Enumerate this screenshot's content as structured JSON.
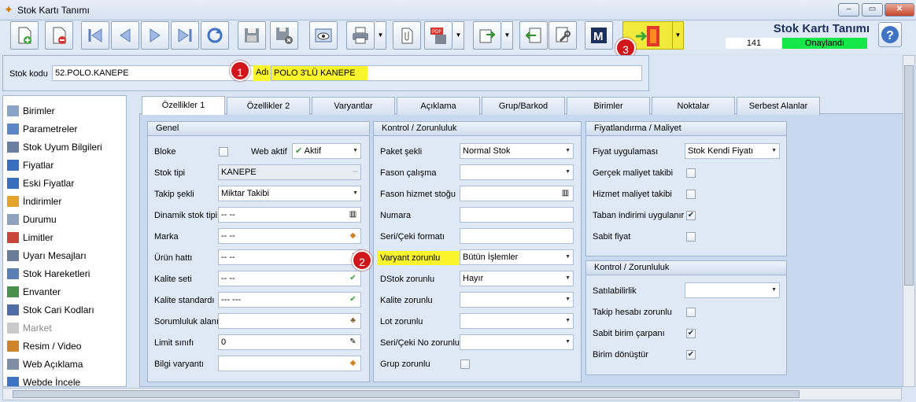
{
  "window": {
    "title": "Stok Kartı Tanımı"
  },
  "header": {
    "form_title": "Stok Kartı Tanımı",
    "record_no": "141",
    "status": "Onaylandı",
    "status_color": "#17e84a"
  },
  "toolbar": {
    "buttons": [
      "new-file",
      "delete-file",
      "first-record",
      "previous-record",
      "next-record",
      "last-record",
      "refresh",
      "save",
      "save-cancel",
      "preview",
      "print",
      "attach",
      "pdf-save",
      "export",
      "import",
      "tools",
      "m-module",
      "exit"
    ]
  },
  "badges": {
    "b1": "1",
    "b2": "2",
    "b3": "3"
  },
  "stock": {
    "code_label": "Stok kodu",
    "code_value": "52.POLO.KANEPE",
    "name_label": "Adı",
    "name_value": "POLO 3'LÜ KANEPE"
  },
  "sidebar": {
    "items": [
      {
        "label": "Birimler",
        "icon": "units-icon"
      },
      {
        "label": "Parametreler",
        "icon": "parameters-icon"
      },
      {
        "label": "Stok Uyum Bilgileri",
        "icon": "compatibility-icon"
      },
      {
        "label": "Fiyatlar",
        "icon": "prices-icon"
      },
      {
        "label": "Eski Fiyatlar",
        "icon": "old-prices-icon"
      },
      {
        "label": "İndirimler",
        "icon": "discounts-icon"
      },
      {
        "label": "Durumu",
        "icon": "status-icon"
      },
      {
        "label": "Limitler",
        "icon": "limits-icon"
      },
      {
        "label": "Uyarı Mesajları",
        "icon": "warning-icon"
      },
      {
        "label": "Stok Hareketleri",
        "icon": "movements-icon"
      },
      {
        "label": "Envanter",
        "icon": "inventory-icon"
      },
      {
        "label": "Stok Cari Kodları",
        "icon": "account-codes-icon"
      },
      {
        "label": "Market",
        "icon": "market-icon"
      },
      {
        "label": "Resim / Video",
        "icon": "media-icon"
      },
      {
        "label": "Web Açıklama",
        "icon": "web-description-icon"
      },
      {
        "label": "Webde İncele",
        "icon": "web-view-icon"
      }
    ]
  },
  "tabs": [
    "Özellikler 1",
    "Özellikler 2",
    "Varyantlar",
    "Açıklama",
    "Grup/Barkod",
    "Birimler",
    "Noktalar",
    "Serbest Alanlar"
  ],
  "genel": {
    "title": "Genel",
    "bloke": "Bloke",
    "web_aktif": "Web aktif",
    "web_aktif_value": "Aktif",
    "stok_tipi": "Stok tipi",
    "stok_tipi_value": "KANEPE",
    "takip": "Takip şekli",
    "takip_value": "Miktar Takibi",
    "dinamik": "Dinamik stok tipi",
    "dinamik_value": "-- --",
    "marka": "Marka",
    "marka_value": "-- --",
    "urun_hatti": "Ürün hattı",
    "urun_hatti_value": "-- --",
    "kalite_seti": "Kalite seti",
    "kalite_seti_value": "-- --",
    "kalite_std": "Kalite standardı",
    "kalite_std_value": "--- ---",
    "sorumluluk": "Sorumluluk alanı",
    "sorumluluk_value": "",
    "limit": "Limit sınıfı",
    "limit_value": "0",
    "bilgi": "Bilgi varyantı",
    "bilgi_value": ""
  },
  "kontrol": {
    "title": "Kontrol / Zorunluluk",
    "paket": "Paket şekli",
    "paket_value": "Normal Stok",
    "fason": "Fason çalışma",
    "fason_value": "",
    "fason_hizmet": "Fason hizmet stoğu",
    "fason_hizmet_value": "",
    "numara": "Numara",
    "numara_value": "",
    "seri_format": "Seri/Çeki formatı",
    "seri_format_value": "",
    "varyant": "Varyant zorunlu",
    "varyant_value": "Bütün İşlemler",
    "dstok": "DStok zorunlu",
    "dstok_value": "Hayır",
    "kalite": "Kalite zorunlu",
    "kalite_value": "",
    "lot": "Lot zorunlu",
    "lot_value": "",
    "seri_no": "Seri/Çeki No zorunlu",
    "seri_no_value": "",
    "grup": "Grup zorunlu"
  },
  "fiyat": {
    "title": "Fiyatlandırma / Maliyet",
    "uygulama": "Fiyat uygulaması",
    "uygulama_value": "Stok Kendi Fiyatı",
    "gercek": "Gerçek maliyet takibi",
    "hizmet": "Hizmet maliyet takibi",
    "taban": "Taban indirimi uygulanır",
    "sabit": "Sabit fiyat"
  },
  "kontrol2": {
    "title": "Kontrol / Zorunluluk",
    "satilabilirlik": "Satılabilirlik",
    "satilabilirlik_value": "",
    "takip_hesabi": "Takip hesabı zorunlu",
    "sabit_birim": "Sabit birim çarpanı",
    "birim_donustur": "Birim dönüştür"
  },
  "colors": {
    "highlight": "#faf42d",
    "badge": "#d0161b",
    "exit": "#f2ea3a"
  }
}
